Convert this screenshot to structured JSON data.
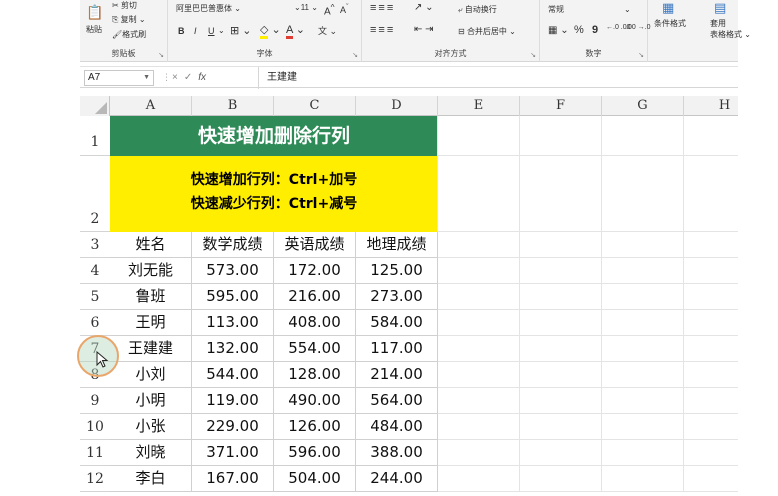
{
  "ribbon": {
    "clipboard": {
      "paste": "粘贴",
      "cut": "剪切",
      "copy": "复制",
      "format_painter": "格式刷",
      "group_label": "剪贴板"
    },
    "font": {
      "font_name": "阿里巴巴普惠体",
      "font_size": "11",
      "grow": "A˄",
      "shrink": "A˅",
      "bold": "B",
      "italic": "I",
      "underline": "U",
      "group_label": "字体",
      "phonetic": "文"
    },
    "alignment": {
      "wrap_text": "自动换行",
      "merge_center": "合并后居中",
      "group_label": "对齐方式"
    },
    "number": {
      "format": "常规",
      "percent": "%",
      "comma": "9",
      "inc_decimal": "←.0 .00",
      "dec_decimal": ".00 →.0",
      "group_label": "数字"
    },
    "styles": {
      "conditional_format": "条件格式",
      "table_format_line1": "套用",
      "table_format_line2": "表格格式"
    }
  },
  "formula_bar": {
    "name_box": "A7",
    "cancel": "×",
    "enter": "✓",
    "fx": "fx",
    "value": "王建建"
  },
  "columns": [
    "A",
    "B",
    "C",
    "D",
    "E",
    "F",
    "G",
    "H"
  ],
  "rows": [
    "1",
    "2",
    "3",
    "4",
    "5",
    "6",
    "7",
    "8",
    "9",
    "10",
    "11",
    "12"
  ],
  "sheet": {
    "title": "快速增加删除行列",
    "subtitle_line1": "快速增加行列：Ctrl+加号",
    "subtitle_line2": "快速减少行列：Ctrl+减号",
    "headers": [
      "姓名",
      "数学成绩",
      "英语成绩",
      "地理成绩"
    ],
    "data": [
      [
        "刘无能",
        "573.00",
        "172.00",
        "125.00"
      ],
      [
        "鲁班",
        "595.00",
        "216.00",
        "273.00"
      ],
      [
        "王明",
        "113.00",
        "408.00",
        "584.00"
      ],
      [
        "王建建",
        "132.00",
        "554.00",
        "117.00"
      ],
      [
        "小刘",
        "544.00",
        "128.00",
        "214.00"
      ],
      [
        "小明",
        "119.00",
        "490.00",
        "564.00"
      ],
      [
        "小张",
        "229.00",
        "126.00",
        "484.00"
      ],
      [
        "刘晓",
        "371.00",
        "596.00",
        "388.00"
      ],
      [
        "李白",
        "167.00",
        "504.00",
        "244.00"
      ]
    ]
  },
  "colors": {
    "title_bg": "#2e8b57",
    "subtitle_bg": "#ffee00",
    "cursor_ring": "#e9a66b"
  }
}
